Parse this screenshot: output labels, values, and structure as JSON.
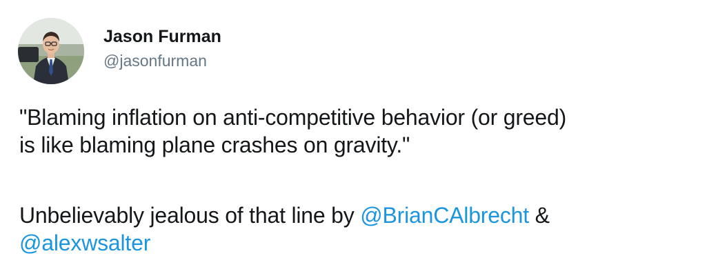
{
  "tweet": {
    "author": {
      "display_name": "Jason Furman",
      "handle": "@jasonfurman",
      "avatar_icon": "profile-photo"
    },
    "quote_line1": "\"Blaming inflation on anti-competitive behavior (or greed)",
    "quote_line2": "is like blaming plane crashes on gravity.\"",
    "line3_prefix": "Unbelievably jealous of that line by ",
    "mention1": "@BrianCAlbrecht",
    "line3_suffix": " &",
    "mention2": "@alexwsalter",
    "colors": {
      "text": "#14171a",
      "secondary": "#657786",
      "link": "#1b95e0"
    }
  }
}
